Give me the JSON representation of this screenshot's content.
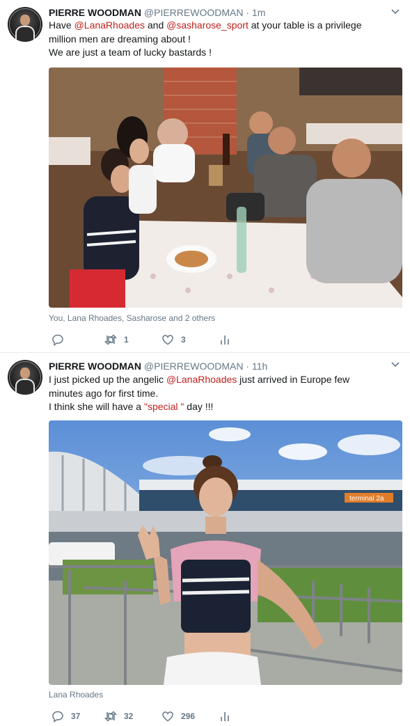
{
  "tweets": [
    {
      "name": "PIERRE WOODMAN",
      "handle": "@PIERREWOODMAN",
      "sep": " · ",
      "time": "1m",
      "line1_a": "Have ",
      "mention1": "@LanaRhoades",
      "line1_b": " and ",
      "mention2": "@sasharose_sport",
      "line1_c": " at your table is a privilege",
      "line2": "million men are dreaming about !",
      "line3": "We are just a team of lucky bastards !",
      "tagged": "You, Lana Rhoades, Sasharose and 2 others",
      "retweets": "1",
      "likes": "3",
      "replies": ""
    },
    {
      "name": "PIERRE WOODMAN",
      "handle": "@PIERREWOODMAN",
      "sep": " · ",
      "time": "11h",
      "line1_a": "I just picked up the angelic ",
      "mention1": "@LanaRhoades",
      "line1_b": " just arrived in Europe few",
      "line2": "minutes ago for first time.",
      "line3_a": "I think she will have a ",
      "line3_special": "\"special \"",
      "line3_b": " day !!!",
      "photo_sign": "terminal 2a",
      "tagged": "Lana Rhoades",
      "replies": "37",
      "retweets": "32",
      "likes": "296"
    }
  ],
  "colors": {
    "mention": "#c0211d",
    "muted": "#657786",
    "text": "#14171a"
  },
  "icons": [
    "reply-icon",
    "retweet-icon",
    "like-icon",
    "analytics-icon",
    "chevron-down-icon"
  ]
}
